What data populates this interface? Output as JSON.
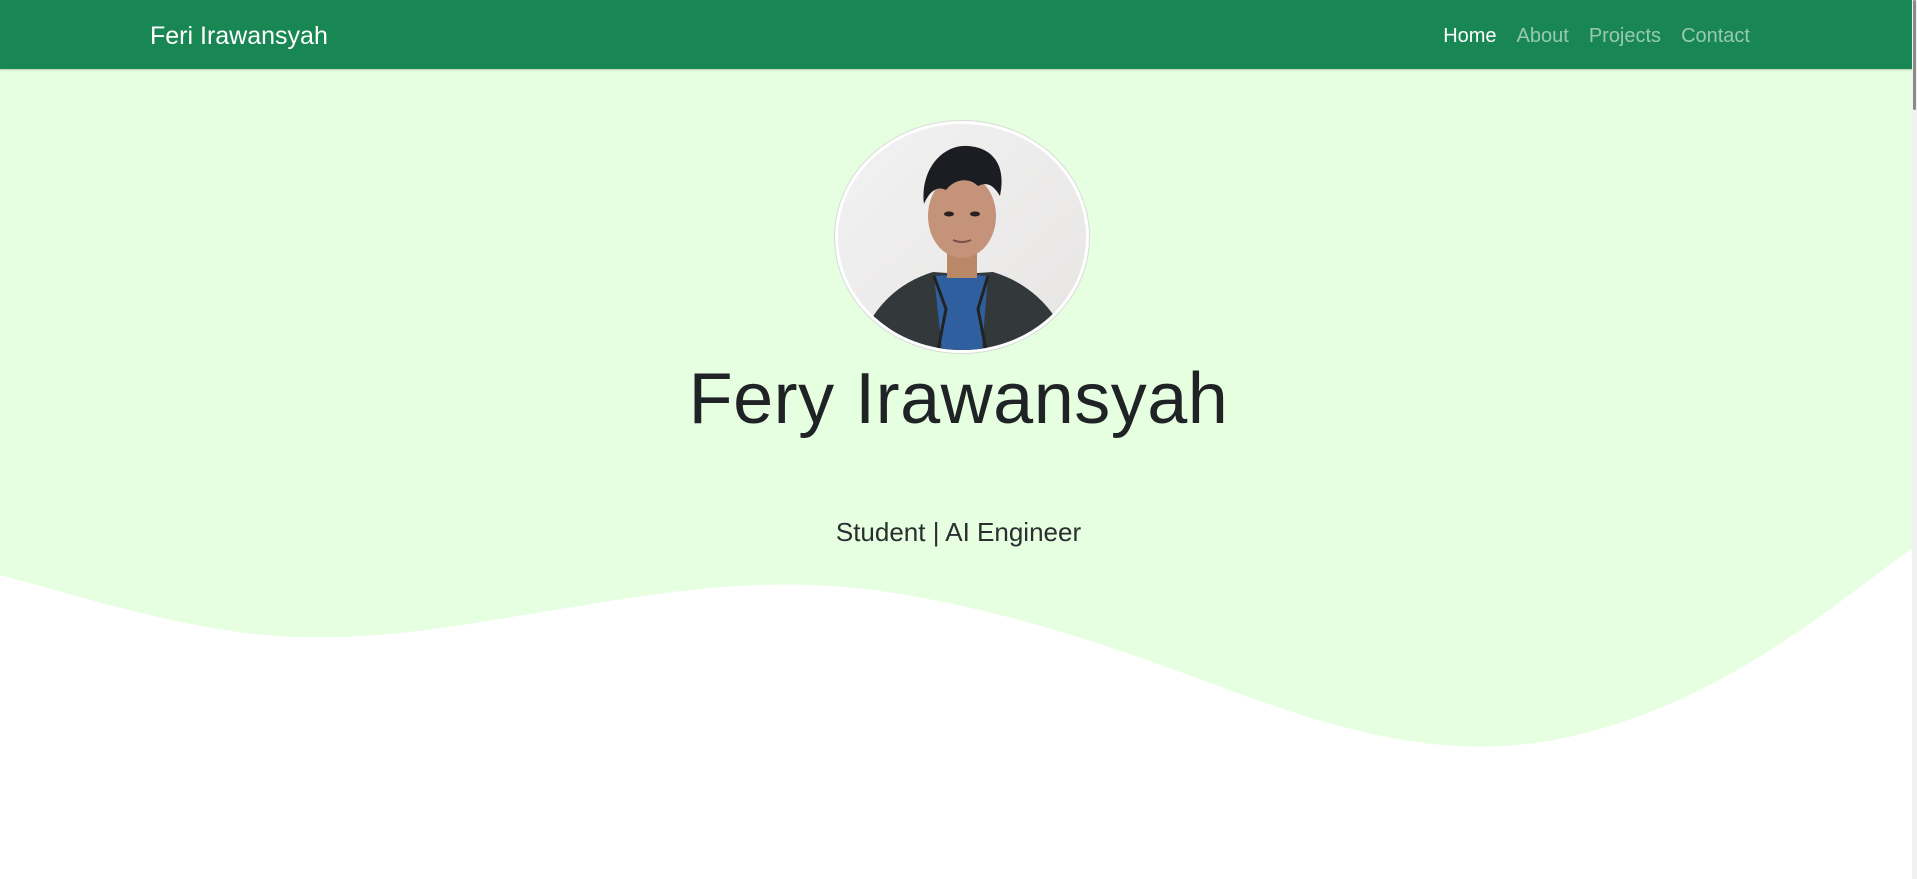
{
  "navbar": {
    "brand": "Feri Irawansyah",
    "links": [
      {
        "label": "Home",
        "active": true
      },
      {
        "label": "About",
        "active": false
      },
      {
        "label": "Projects",
        "active": false
      },
      {
        "label": "Contact",
        "active": false
      }
    ]
  },
  "hero": {
    "name": "Fery Irawansyah",
    "subtitle": "Student | AI Engineer"
  },
  "colors": {
    "navbar_bg": "#198754",
    "hero_bg": "#e6ffe0",
    "page_bg": "#ffffff",
    "text_dark": "#1f2326"
  },
  "icons": {
    "avatar": "profile-photo"
  }
}
